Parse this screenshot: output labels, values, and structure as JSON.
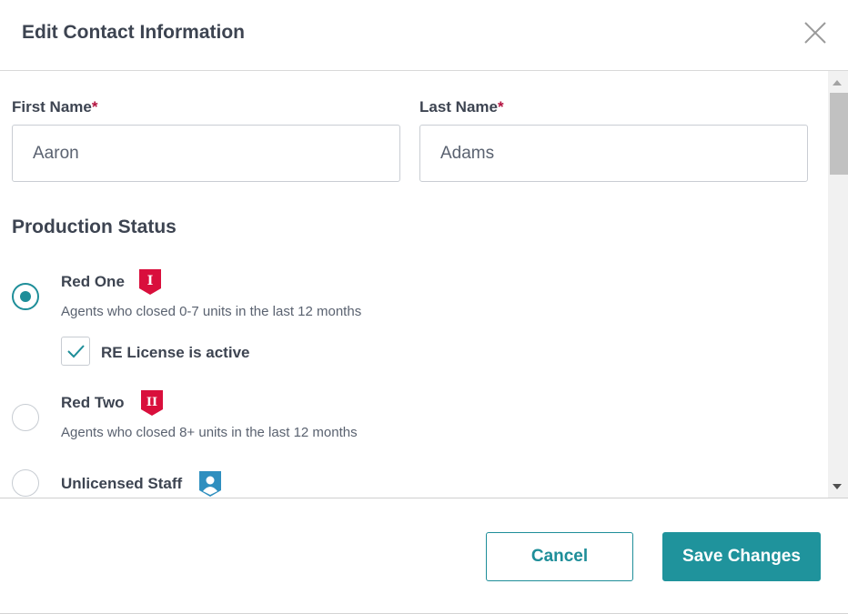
{
  "modal": {
    "title": "Edit Contact Information"
  },
  "form": {
    "first_name": {
      "label": "First Name",
      "required_mark": "*",
      "value": "Aaron"
    },
    "last_name": {
      "label": "Last Name",
      "required_mark": "*",
      "value": "Adams"
    },
    "production_status": {
      "heading": "Production Status",
      "options": [
        {
          "title": "Red One",
          "description": "Agents who closed 0-7 units in the last 12 months",
          "badge_icon": "red-one-shield-icon",
          "badge_text": "I",
          "selected": true
        },
        {
          "title": "Red Two",
          "description": "Agents who closed 8+ units in the last 12 months",
          "badge_icon": "red-two-shield-icon",
          "badge_text": "II",
          "selected": false
        },
        {
          "title": "Unlicensed Staff",
          "badge_icon": "person-shield-icon",
          "selected": false
        }
      ],
      "license_checkbox": {
        "label": "RE License is active",
        "checked": true
      }
    }
  },
  "footer": {
    "cancel_label": "Cancel",
    "save_label": "Save Changes"
  },
  "colors": {
    "accent": "#1f939c",
    "badge_red": "#d90f3c",
    "badge_blue": "#2f8fbf",
    "required": "#b3123f"
  }
}
